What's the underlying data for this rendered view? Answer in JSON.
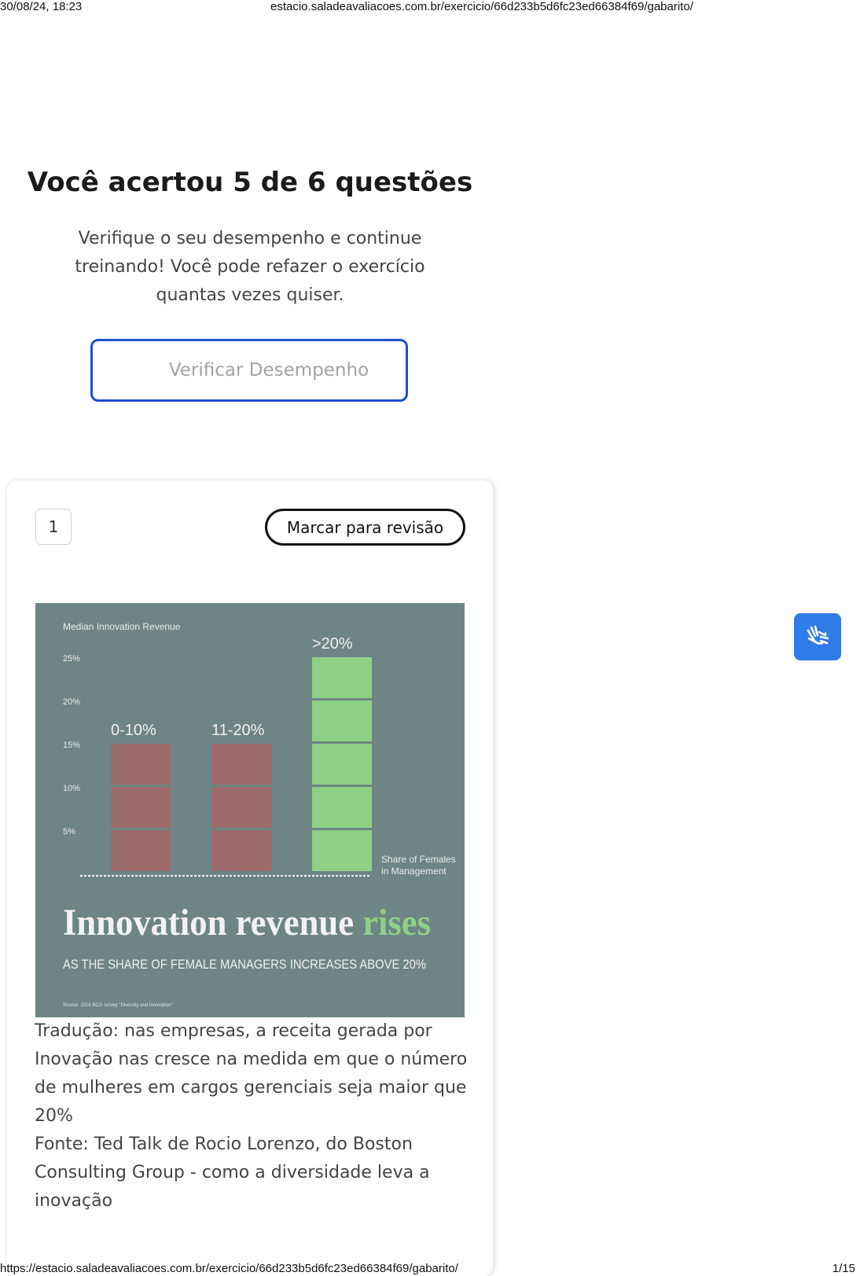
{
  "print_header": {
    "datetime": "30/08/24, 18:23",
    "url": "estacio.saladeavaliacoes.com.br/exercicio/66d233b5d6fc23ed66384f69/gabarito/"
  },
  "result": {
    "title": "Você acertou 5 de 6 questões",
    "subtitle": "Verifique o seu desempenho e continue treinando! Você pode refazer o exercício quantas vezes quiser.",
    "verify_button": "Verificar Desempenho"
  },
  "question": {
    "number": "1",
    "review_button": "Marcar para revisão",
    "caption_translation": "Tradução: nas empresas, a receita gerada por Inovação nas cresce na medida em que o número de mulheres em cargos gerenciais seja maior que 20%",
    "caption_source": "Fonte: Ted Talk de Rocio Lorenzo, do Boston Consulting Group - como a diversidade leva a inovação"
  },
  "infographic": {
    "ylabel": "Median Innovation Revenue",
    "yticks": [
      "25%",
      "20%",
      "15%",
      "10%",
      "5%"
    ],
    "bars": [
      {
        "label": "0-10%",
        "blocks": 3,
        "color": "#9b6b6e"
      },
      {
        "label": "11-20%",
        "blocks": 3,
        "color": "#9b6b6e"
      },
      {
        "label": ">20%",
        "blocks": 5,
        "color": "#8fcf86"
      }
    ],
    "xlabel_line1": "Share of Females",
    "xlabel_line2": "in Management",
    "headline_main": "Innovation revenue",
    "headline_accent": "rises",
    "headline_sub": "AS THE SHARE OF FEMALE MANAGERS INCREASES ABOVE 20%",
    "source": "Source: 2016 BCG survey \"Diversity and Innovation\""
  },
  "print_footer": {
    "url": "https://estacio.saladeavaliacoes.com.br/exercicio/66d233b5d6fc23ed66384f69/gabarito/",
    "page": "1/15"
  },
  "accessibility": {
    "icon": "sign-language-hands-icon",
    "color": "#2f7ce8"
  }
}
